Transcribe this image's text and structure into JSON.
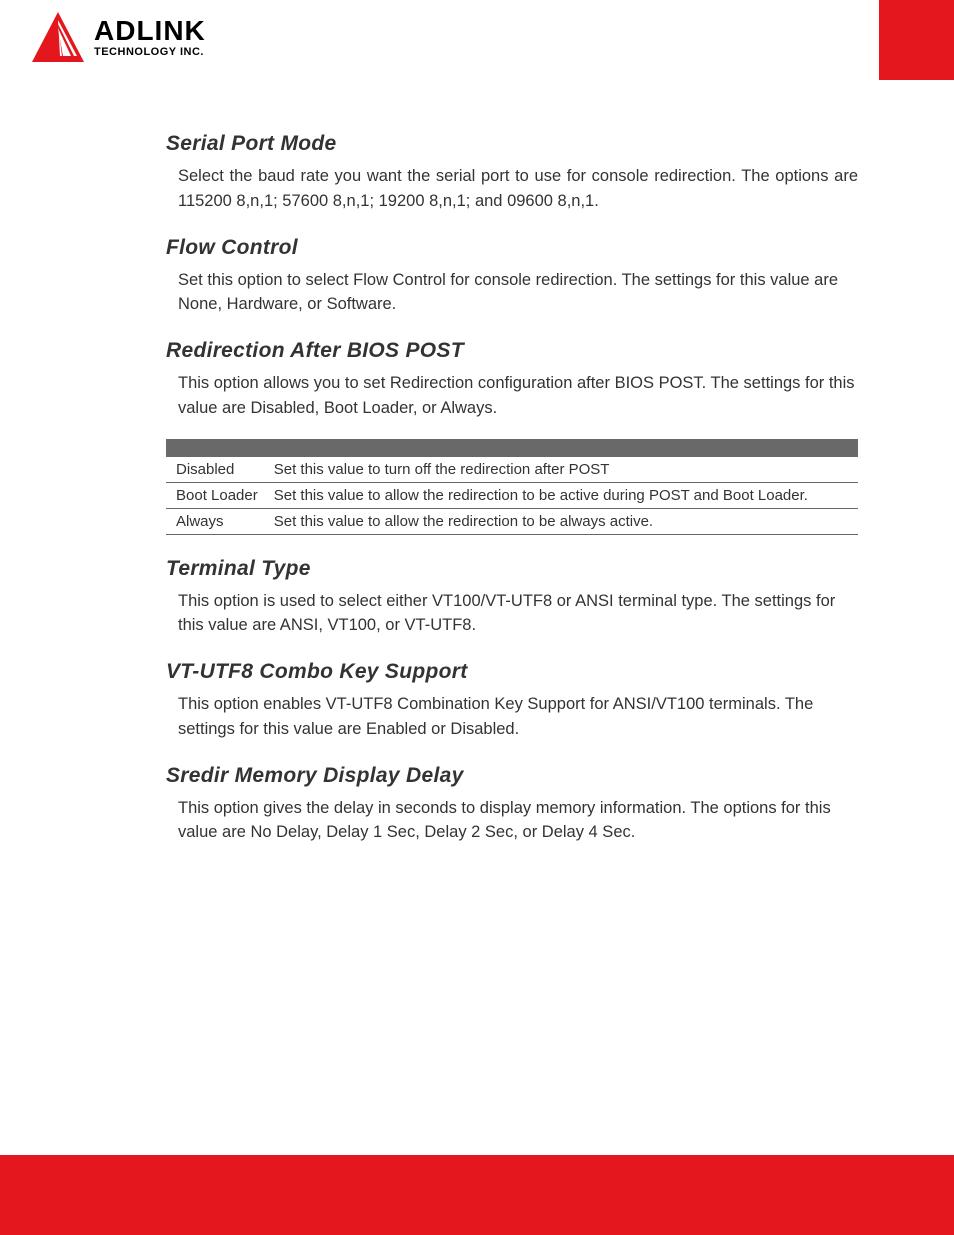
{
  "logo": {
    "brand_main": "ADLINK",
    "brand_sub": "TECHNOLOGY INC."
  },
  "sections": {
    "serial_port_mode": {
      "title": "Serial Port Mode",
      "body": "Select the baud rate you want the serial port to use for console redirection. The options are 115200 8,n,1; 57600 8,n,1; 19200 8,n,1; and 09600 8,n,1."
    },
    "flow_control": {
      "title": "Flow Control",
      "body": "Set this option to select Flow Control for console redirection. The settings for this value are None, Hardware, or Software."
    },
    "redir_after_post": {
      "title": "Redirection After BIOS POST",
      "body": "This option allows you to set Redirection configuration after BIOS POST. The settings for this value are Disabled, Boot Loader, or Always.",
      "rows": [
        {
          "k": "Disabled",
          "v": "Set this value to turn off the redirection after POST"
        },
        {
          "k": "Boot Loader",
          "v": "Set this value to allow the redirection to be active during POST and Boot Loader."
        },
        {
          "k": "Always",
          "v": "Set this value to allow the redirection to be always active."
        }
      ]
    },
    "terminal_type": {
      "title": "Terminal Type",
      "body": "This option is used to select either VT100/VT-UTF8 or ANSI terminal type. The settings for this value are ANSI, VT100, or VT-UTF8."
    },
    "vt_utf8": {
      "title": "VT-UTF8 Combo Key Support",
      "body": "This option enables VT-UTF8 Combination Key Support for ANSI/VT100 terminals. The settings for this value are Enabled or Disabled."
    },
    "sredir": {
      "title": "Sredir Memory Display Delay",
      "body": "This option gives the delay in seconds to display memory information. The options for this value are No Delay, Delay 1 Sec, Delay 2 Sec, or Delay 4 Sec."
    }
  }
}
